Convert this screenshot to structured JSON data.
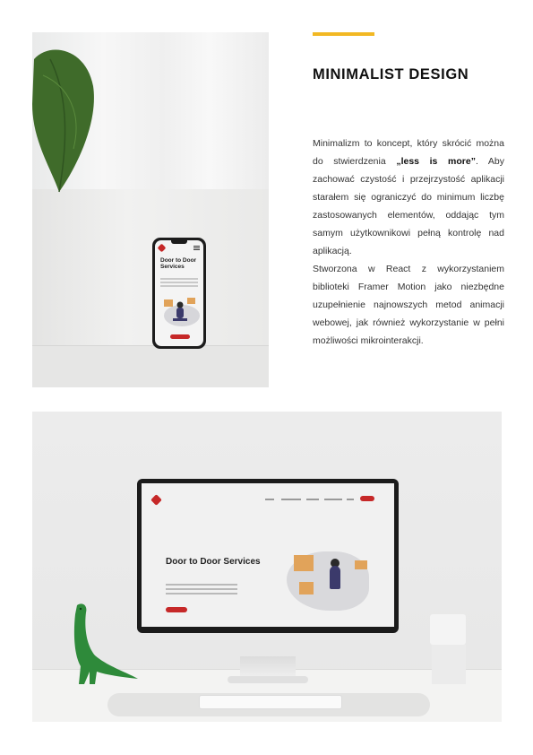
{
  "section": {
    "title": "MINIMALIST DESIGN",
    "accent_color": "#f2b823"
  },
  "description": {
    "p1_before": "Minimalizm to koncept, który skrócić można do stwierdzenia ",
    "p1_bold": "„less is more”",
    "p1_after": ". Aby zachować czystość i przejrzystość aplikacji starałem się ograniczyć do minimum liczbę zastosowanych elementów, oddając tym samym użytkownikowi pełną kontrolę nad aplikacją.",
    "p2": "Stworzona w React z wykorzystaniem biblioteki Framer Motion jako niezbędne uzupełnienie najnowszych metod animacji webowej, jak również wykorzystanie w pełni możliwości mikrointerakcji."
  },
  "mockup_phone": {
    "title": "Door to Door Services",
    "brand_color": "#c62828"
  },
  "mockup_desktop": {
    "title": "Door to Door Services",
    "brand_color": "#c62828"
  }
}
